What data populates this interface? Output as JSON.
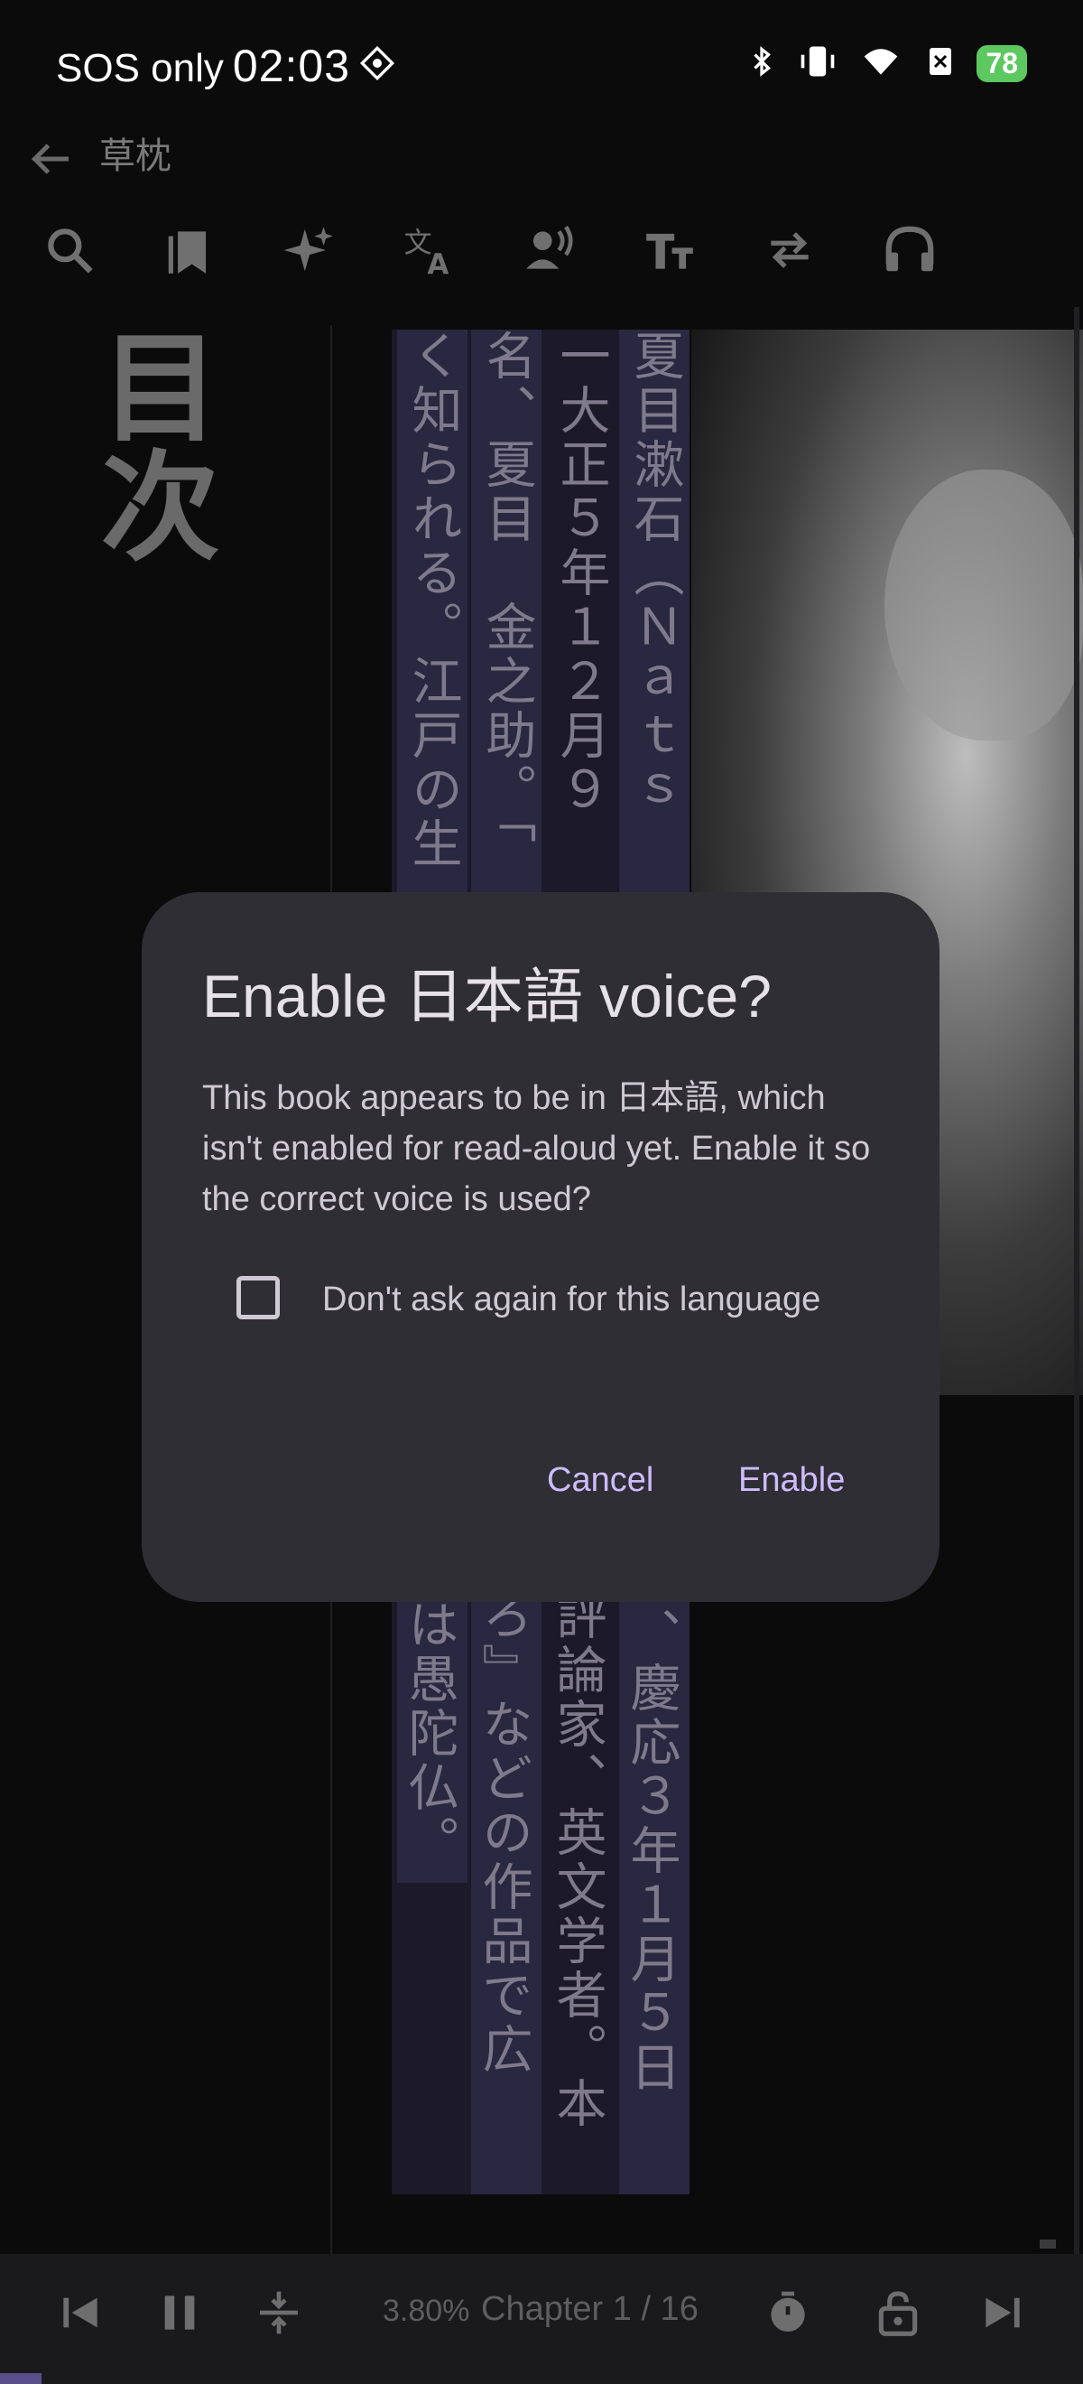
{
  "status_bar": {
    "carrier": "SOS only",
    "time": "02:03",
    "battery": "78"
  },
  "header": {
    "book_title": "草枕"
  },
  "toolbar": {
    "icons": [
      "search-icon",
      "bookmark-icon",
      "sparkle-icon",
      "translate-icon",
      "read-aloud-icon",
      "text-size-icon",
      "swap-icon",
      "headphones-icon"
    ]
  },
  "reader": {
    "toc_heading": "目次",
    "columns": [
      "夏目漱石（Ｎａｔｓ",
      "一大正５年１２月９",
      "名、夏目　金之助。「",
      "く知られる。江戸の生"
    ],
    "columns_lower": [
      "、慶応３年１月５日",
      "評論家、英文学者。本",
      "ろ』などの作品で広",
      "は愚陀仏。"
    ]
  },
  "dialog": {
    "title": "Enable 日本語 voice?",
    "body": "This book appears to be in 日本語, which isn't enabled for read-aloud yet. Enable it so the correct voice is used?",
    "checkbox_label": "Don't ask again for this language",
    "cancel_label": "Cancel",
    "enable_label": "Enable"
  },
  "bottom_bar": {
    "progress_percent": "3.80%",
    "chapter": "Chapter 1 / 16",
    "progress_fraction": 0.038
  }
}
